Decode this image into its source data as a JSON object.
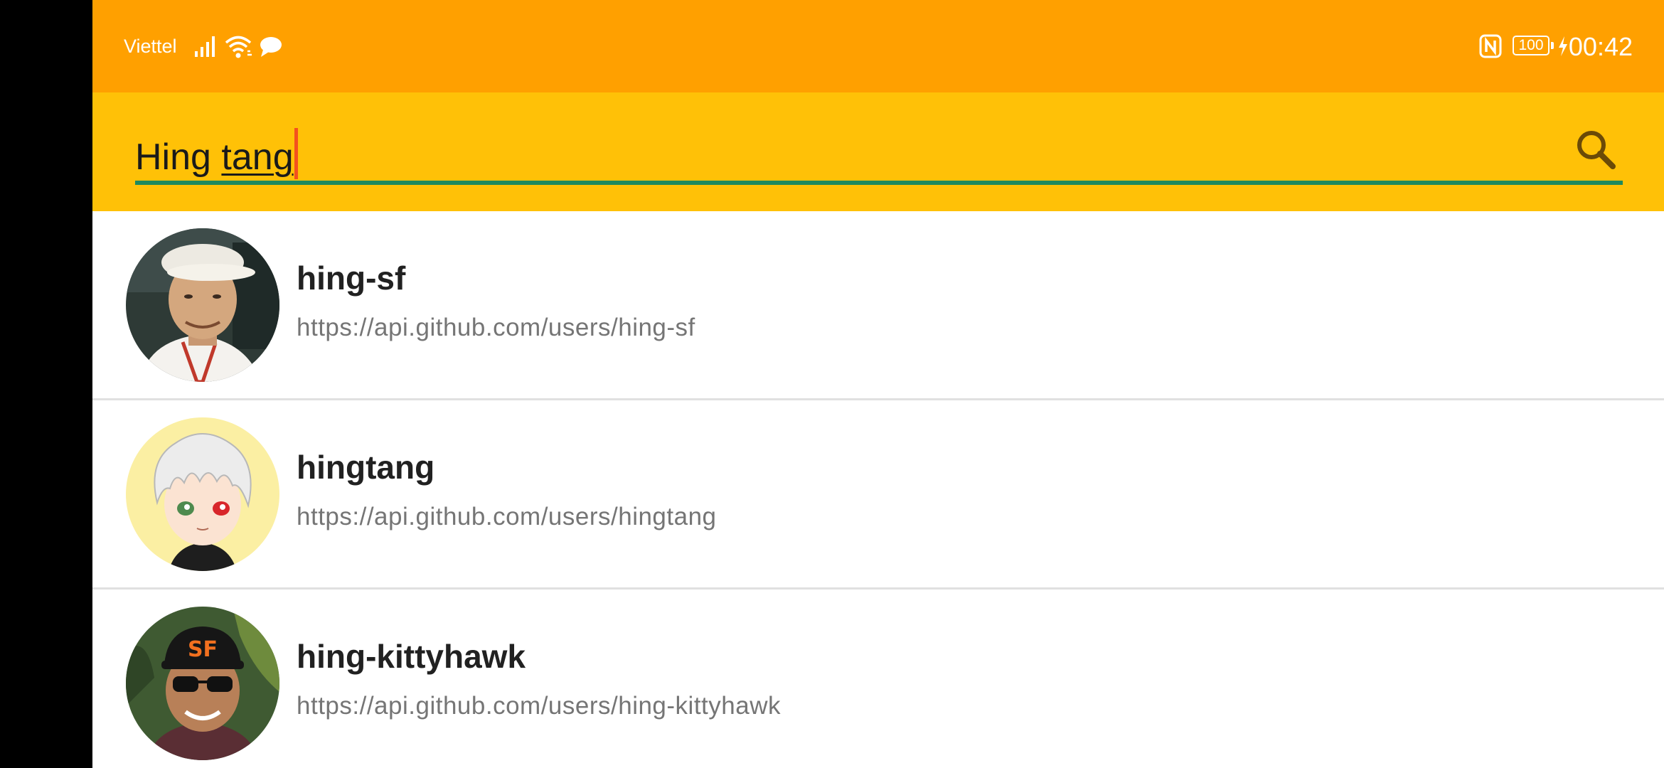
{
  "status_bar": {
    "carrier": "Viettel",
    "battery_level": "100",
    "time": "00:42",
    "icons": [
      "signal-icon",
      "wifi-icon",
      "message-icon",
      "nfc-icon",
      "battery-icon",
      "charging-icon"
    ]
  },
  "search": {
    "value_prefix": "Hing ",
    "value_composing": "tang",
    "underline_color": "#1E8A5E",
    "caret_color": "#F4511E"
  },
  "colors": {
    "status_bar_bg": "#FFA000",
    "toolbar_bg": "#FFC107"
  },
  "users": [
    {
      "login": "hing-sf",
      "url": "https://api.github.com/users/hing-sf",
      "avatar": "avatar-photo-man-white-cap"
    },
    {
      "login": "hingtang",
      "url": "https://api.github.com/users/hingtang",
      "avatar": "avatar-anime-white-hair"
    },
    {
      "login": "hing-kittyhawk",
      "url": "https://api.github.com/users/hing-kittyhawk",
      "avatar": "avatar-photo-man-sf-cap-sunglasses"
    }
  ]
}
